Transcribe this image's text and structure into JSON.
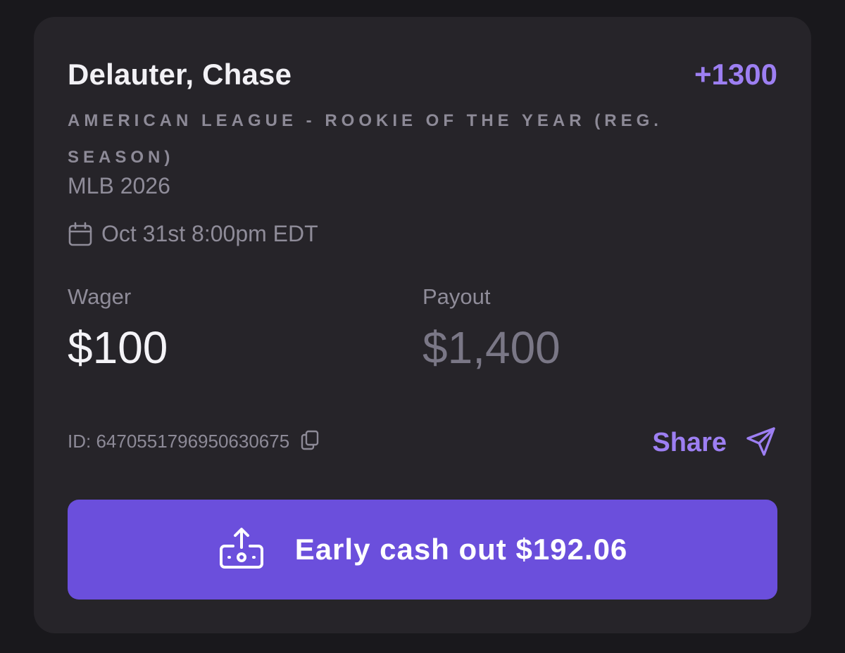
{
  "bet": {
    "player": "Delauter, Chase",
    "odds": "+1300",
    "market": "AMERICAN LEAGUE - ROOKIE OF THE YEAR (REG. SEASON)",
    "league": "MLB 2026",
    "date": "Oct 31st 8:00pm EDT"
  },
  "amounts": {
    "wager_label": "Wager",
    "wager_value": "$100",
    "payout_label": "Payout",
    "payout_value": "$1,400"
  },
  "footer": {
    "id_text": "ID: 6470551796950630675",
    "share_label": "Share"
  },
  "cashout": {
    "label": "Early cash out $192.06"
  },
  "colors": {
    "background": "#19181c",
    "card": "#262429",
    "accent": "#9d7ff2",
    "button": "#6b4fdc"
  },
  "icons": {
    "date": "calendar-icon",
    "copy": "copy-icon",
    "share": "send-icon",
    "cashout": "cash-out-icon"
  }
}
